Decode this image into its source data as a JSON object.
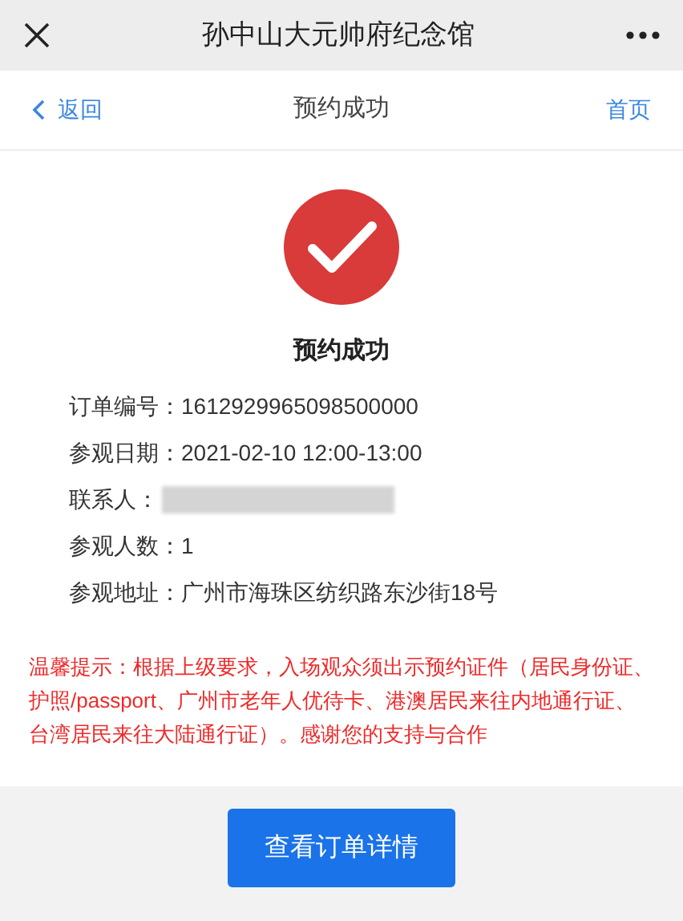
{
  "window": {
    "title": "孙中山大元帅府纪念馆"
  },
  "nav": {
    "back": "返回",
    "title": "预约成功",
    "home": "首页"
  },
  "result": {
    "title": "预约成功"
  },
  "fields": [
    {
      "label": "订单编号：",
      "value": "1612929965098500000"
    },
    {
      "label": "参观日期：",
      "value": "2021-02-10 12:00-13:00"
    },
    {
      "label": "联系人：",
      "redacted": true
    },
    {
      "label": "参观人数：",
      "value": "1"
    },
    {
      "label": "参观地址：",
      "value": "广州市海珠区纺织路东沙街18号"
    }
  ],
  "notice": "温馨提示：根据上级要求，入场观众须出示预约证件（居民身份证、护照/passport、广州市老年人优待卡、港澳居民来往内地通行证、台湾居民来往大陆通行证）。感谢您的支持与合作",
  "button": "查看订单详情"
}
